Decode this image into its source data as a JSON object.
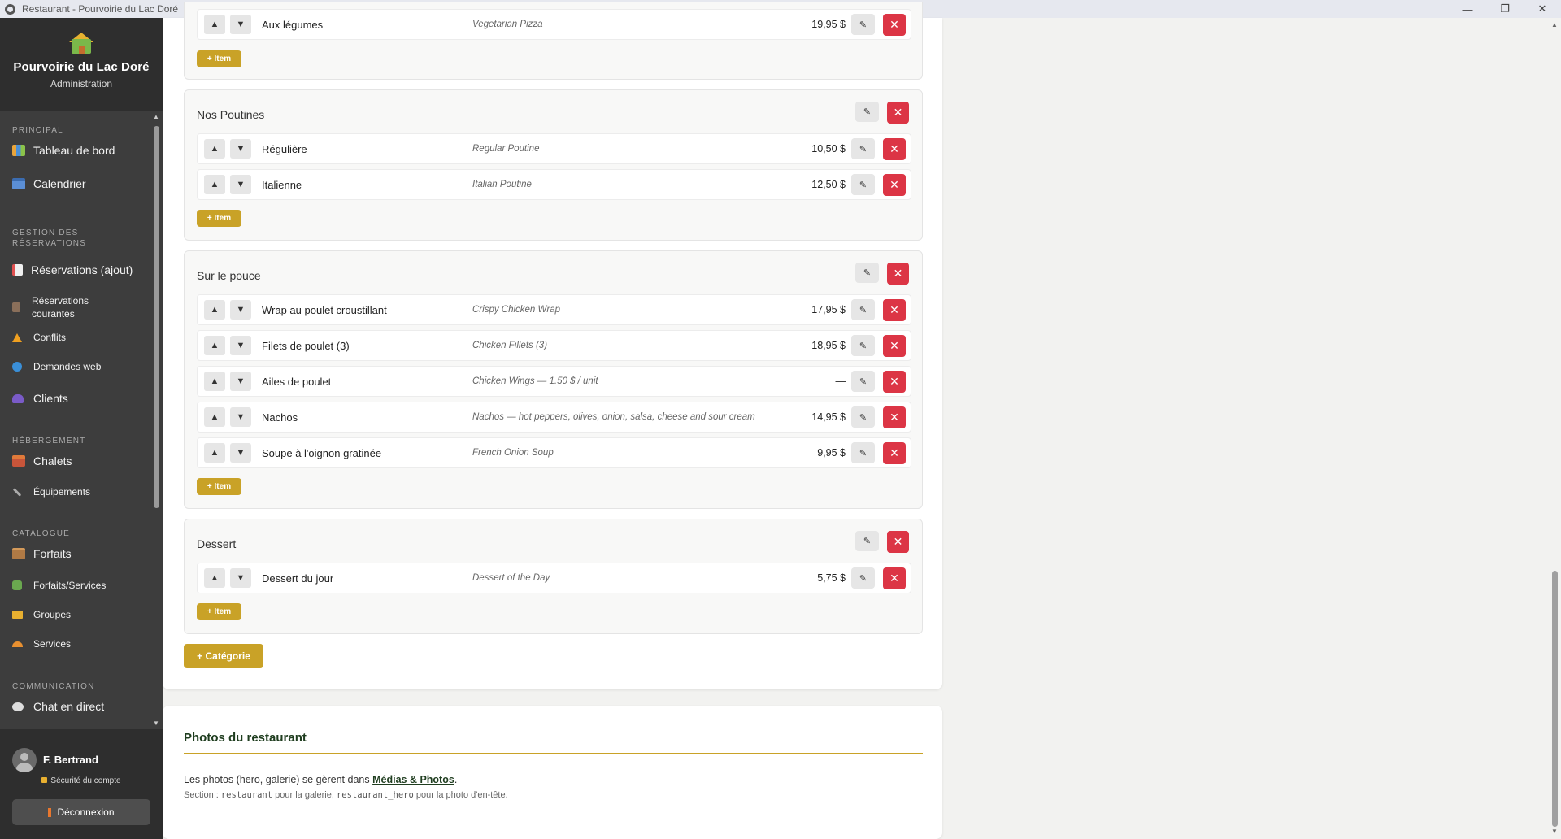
{
  "window": {
    "title": "Restaurant - Pourvoirie du Lac Doré",
    "controls": [
      "—",
      "❐",
      "✕"
    ]
  },
  "sidebar": {
    "brand_name": "Pourvoirie du Lac Doré",
    "brand_sub": "Administration",
    "sections": {
      "principal": "PRINCIPAL",
      "reservations": "GESTION DES RÉSERVATIONS",
      "hebergement": "HÉBERGEMENT",
      "catalogue": "CATALOGUE",
      "communication": "COMMUNICATION"
    },
    "items": {
      "dashboard": "Tableau de bord",
      "calendar": "Calendrier",
      "reservations_add": "Réservations (ajout)",
      "reservations_current": "Réservations courantes",
      "conflicts": "Conflits",
      "web_requests": "Demandes web",
      "clients": "Clients",
      "chalets": "Chalets",
      "equipment": "Équipements",
      "packages": "Forfaits",
      "packages_services": "Forfaits/Services",
      "groups": "Groupes",
      "services": "Services",
      "live_chat": "Chat en direct"
    },
    "user": {
      "name": "F. Bertrand",
      "security": "Sécurité du compte",
      "logout": "Déconnexion"
    }
  },
  "menu": {
    "first_item": {
      "name": "Aux légumes",
      "desc": "Vegetarian Pizza",
      "price": "19,95 $"
    },
    "add_item_label": "+ Item",
    "add_category_label": "+ Catégorie",
    "categories": [
      {
        "title": "Nos Poutines",
        "items": [
          {
            "name": "Régulière",
            "desc": "Regular Poutine",
            "price": "10,50 $"
          },
          {
            "name": "Italienne",
            "desc": "Italian Poutine",
            "price": "12,50 $"
          }
        ]
      },
      {
        "title": "Sur le pouce",
        "items": [
          {
            "name": "Wrap au poulet croustillant",
            "desc": "Crispy Chicken Wrap",
            "price": "17,95 $"
          },
          {
            "name": "Filets de poulet (3)",
            "desc": "Chicken Fillets (3)",
            "price": "18,95 $"
          },
          {
            "name": "Ailes de poulet",
            "desc": "Chicken Wings — 1.50 $ / unit",
            "price": "—"
          },
          {
            "name": "Nachos",
            "desc": "Nachos — hot peppers, olives, onion, salsa, cheese and sour cream",
            "price": "14,95 $"
          },
          {
            "name": "Soupe à l'oignon gratinée",
            "desc": "French Onion Soup",
            "price": "9,95 $"
          }
        ]
      },
      {
        "title": "Dessert",
        "items": [
          {
            "name": "Dessert du jour",
            "desc": "Dessert of the Day",
            "price": "5,75 $"
          }
        ]
      }
    ]
  },
  "photos": {
    "title": "Photos du restaurant",
    "text_before": "Les photos (hero, galerie) se gèrent dans ",
    "link": "Médias & Photos",
    "text_after": ".",
    "section_prefix": "Section : ",
    "code1": "restaurant",
    "mid": " pour la galerie, ",
    "code2": "restaurant_hero",
    "section_suffix": " pour la photo d'en-tête."
  },
  "icons": {
    "up": "▲",
    "down": "▼",
    "edit": "✎",
    "delete": "✕"
  },
  "colors": {
    "accent": "#c9a227",
    "danger": "#dc3545",
    "sidebar": "#3d3d3d",
    "sidebar_dark": "#2e2e2e",
    "heading": "#1f3d1f"
  }
}
